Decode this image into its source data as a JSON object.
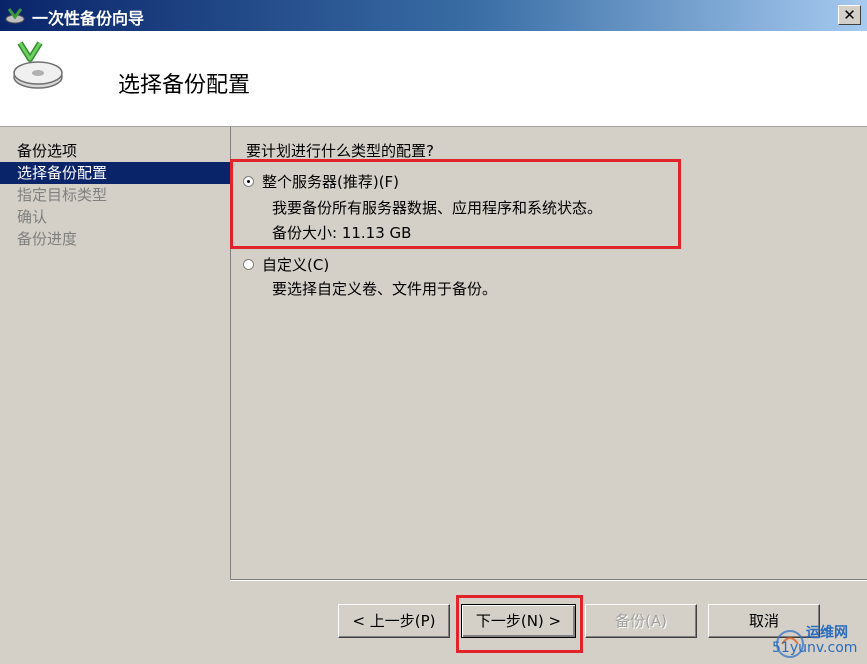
{
  "window": {
    "title": "一次性备份向导",
    "close_glyph": "✕"
  },
  "header": {
    "title": "选择备份配置"
  },
  "nav": {
    "items": [
      {
        "label": "备份选项",
        "state": "done"
      },
      {
        "label": "选择备份配置",
        "state": "active"
      },
      {
        "label": "指定目标类型",
        "state": "pending"
      },
      {
        "label": "确认",
        "state": "pending"
      },
      {
        "label": "备份进度",
        "state": "pending"
      }
    ]
  },
  "main": {
    "question": "要计划进行什么类型的配置?",
    "options": [
      {
        "label": "整个服务器(推荐)(F)",
        "desc": "我要备份所有服务器数据、应用程序和系统状态。",
        "size": "备份大小: 11.13 GB",
        "selected": true
      },
      {
        "label": "自定义(C)",
        "desc": "要选择自定义卷、文件用于备份。",
        "selected": false
      }
    ]
  },
  "buttons": {
    "back": "< 上一步(P)",
    "next": "下一步(N) >",
    "backup": "备份(A)",
    "cancel": "取消"
  },
  "watermark": {
    "line1": "运维网",
    "line2": "51yunv.com"
  },
  "colors": {
    "highlight": "#e0242a",
    "nav_active": "#0a246a",
    "title_bar": "#0a246a"
  }
}
